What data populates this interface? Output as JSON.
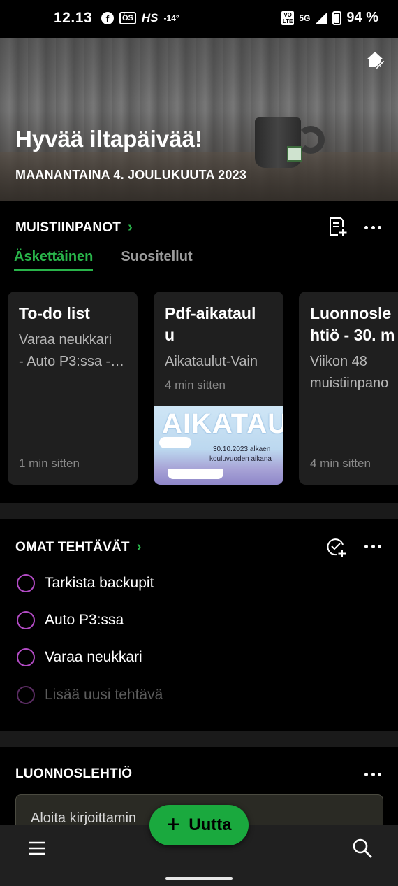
{
  "status_bar": {
    "time": "12.13",
    "left_icons": [
      "facebook-icon",
      "news-icon",
      "hs-icon"
    ],
    "news_label": "ÖS",
    "hs_label": "HS",
    "temperature": "-14°",
    "volte_label": "VO LTE",
    "network": "5G",
    "battery": "94 %"
  },
  "header": {
    "greeting": "Hyvää iltapäivää!",
    "date": "MAANANTAINA 4. JOULUKUUTA 2023"
  },
  "notes": {
    "title": "MUISTIINPANOT",
    "tabs": [
      "Äskettäinen",
      "Suositellut"
    ],
    "cards": [
      {
        "title": "To-do list",
        "body": "Varaa neukkari\n- Auto P3:ssa -…",
        "time": "1 min sitten"
      },
      {
        "title": "Pdf-aikataul\nu",
        "body": "Aikataulut-Vain",
        "time": "4 min sitten",
        "thumb_title": "AIKATAUL",
        "thumb_line1": "30.10.2023 alkaen",
        "thumb_line2": "kouluvuoden aikana"
      },
      {
        "title": "Luonnosle\nhtiö - 30. m",
        "body": "Viikon 48\nmuistiinpano",
        "time": "4 min sitten"
      }
    ]
  },
  "tasks": {
    "title": "OMAT TEHTÄVÄT",
    "items": [
      "Tarkista backupit",
      "Auto P3:ssa",
      "Varaa neukkari"
    ],
    "placeholder": "Lisää uusi tehtävä"
  },
  "sketchpad": {
    "title": "LUONNOSLEHTIÖ",
    "placeholder": "Aloita kirjoittamin"
  },
  "fab": {
    "label": "Uutta"
  },
  "colors": {
    "accent": "#1aa93e",
    "task_circle": "#b24bc4"
  }
}
